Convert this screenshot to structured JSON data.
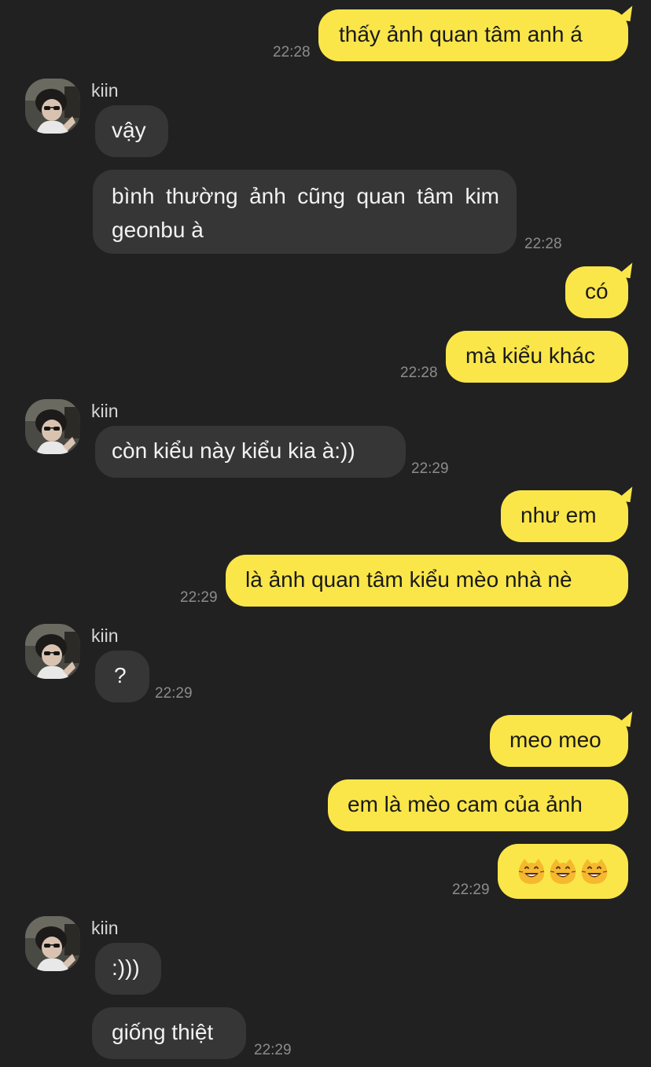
{
  "chat": {
    "contact_name": "kiin",
    "messages": [
      {
        "from": "me",
        "text": "thấy ảnh quan tâm anh á",
        "time": "22:28"
      },
      {
        "from": "kiin",
        "text": "vậy"
      },
      {
        "from": "kiin",
        "text": "bình thường ảnh cũng quan tâm kim geonbu à",
        "time": "22:28"
      },
      {
        "from": "me",
        "text": "có"
      },
      {
        "from": "me",
        "text": "mà kiểu khác",
        "time": "22:28"
      },
      {
        "from": "kiin",
        "text": "còn kiểu này kiểu kia à:))",
        "time": "22:29"
      },
      {
        "from": "me",
        "text": "như em"
      },
      {
        "from": "me",
        "text": "là ảnh quan tâm kiểu mèo nhà nè",
        "time": "22:29"
      },
      {
        "from": "kiin",
        "text": "?",
        "time": "22:29"
      },
      {
        "from": "me",
        "text": "meo meo"
      },
      {
        "from": "me",
        "text": "em là mèo cam của ảnh"
      },
      {
        "from": "me",
        "emoji": [
          "grinning-cat",
          "grinning-cat",
          "grinning-cat"
        ],
        "time": "22:29"
      },
      {
        "from": "kiin",
        "text": ":)))"
      },
      {
        "from": "kiin",
        "text": "giống thiệt",
        "time": "22:29"
      }
    ]
  },
  "colors": {
    "background": "#212121",
    "outgoing_bubble": "#fbe64a",
    "incoming_bubble": "#363636",
    "timestamp": "#8c8c8c"
  }
}
